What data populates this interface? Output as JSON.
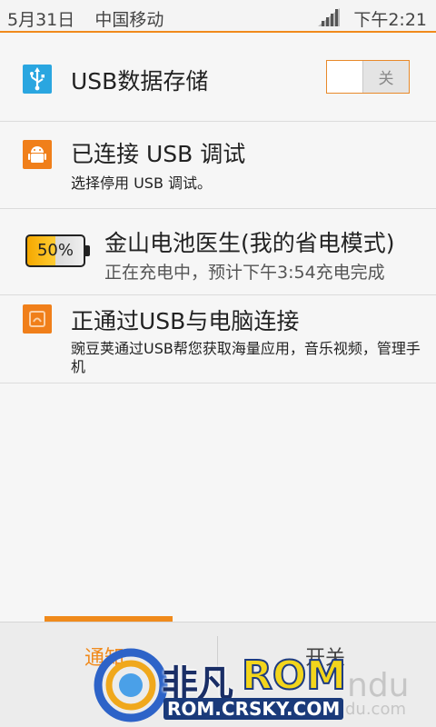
{
  "status_bar": {
    "date": "5月31日",
    "carrier": "中国移动",
    "time": "下午2:21",
    "accent_color": "#f08a1c"
  },
  "notifications": [
    {
      "icon": "usb-icon",
      "icon_color": "#2aa6e0",
      "title": "USB数据存储",
      "toggle_label": "关",
      "toggle_state": "off"
    },
    {
      "icon": "android-debug-icon",
      "icon_color": "#f07f1a",
      "title": "已连接 USB 调试",
      "subtitle": "选择停用 USB 调试。"
    },
    {
      "icon": "battery-icon",
      "battery_level": "50%",
      "title": "金山电池医生(我的省电模式)",
      "subtitle": "正在充电中，预计下午3:54充电完成"
    },
    {
      "icon": "wandoujia-icon",
      "icon_color": "#f07f1a",
      "title": "正通过USB与电脑连接",
      "subtitle": "豌豆荚通过USB帮您获取海量应用，音乐视频，管理手机"
    }
  ],
  "tabs": [
    {
      "label": "通知",
      "active": true
    },
    {
      "label": "开关",
      "active": false
    }
  ],
  "watermark": {
    "brand": "非凡",
    "rom": "ROM",
    "url": "ROM.CRSKY.COM",
    "partial_right": "ndu",
    "partial_right_2": "du.com"
  }
}
